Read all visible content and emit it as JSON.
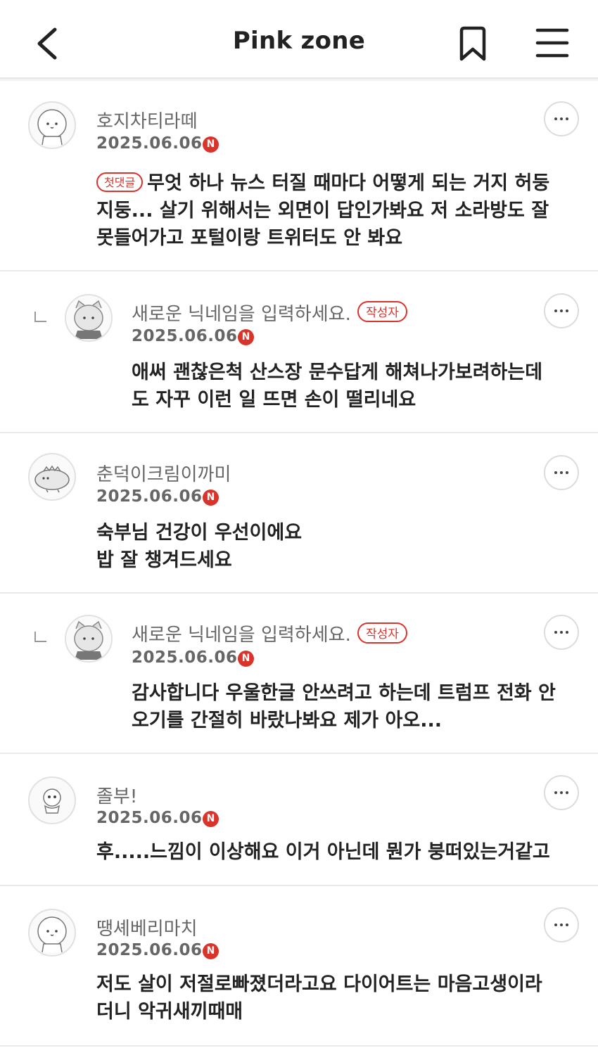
{
  "header": {
    "title": "Pink zone"
  },
  "icons": {
    "back": "chevron-left-icon",
    "bookmark": "bookmark-icon",
    "menu": "hamburger-menu-icon",
    "more": "more-horizontal-icon"
  },
  "colors": {
    "accent": "#d9342b",
    "text": "#222222",
    "muted": "#666666"
  },
  "badges": {
    "new": "N",
    "author": "작성자",
    "first_comment": "첫댓글"
  },
  "comments": [
    {
      "nickname": "호지차티라떼",
      "date": "2025.06.06",
      "line1": "무엇 하나 뉴스 터질 때마다 어떻게 되는 거지 허둥",
      "line2": "지둥... 살기 위해서는 외면이 답인가봐요 저 소라방도 잘",
      "line3": "못들어가고 포털이랑 트위터도 안 봐요"
    },
    {
      "nickname": "새로운 닉네임을 입력하세요.",
      "date": "2025.06.06",
      "line1": "애써 괜찮은척 산스장 문수답게 해쳐나가보려하는데",
      "line2": "도 자꾸 이런 일 뜨면 손이 떨리네요"
    },
    {
      "nickname": "춘덕이크림이까미",
      "date": "2025.06.06",
      "line1": "숙부님 건강이 우선이에요",
      "line2": "밥 잘 챙겨드세요"
    },
    {
      "nickname": "새로운 닉네임을 입력하세요.",
      "date": "2025.06.06",
      "line1": "감사합니다 우울한글 안쓰려고 하는데 트럼프 전화 안",
      "line2": "오기를 간절히 바랐나봐요 제가 아오..."
    },
    {
      "nickname": "졸부!",
      "date": "2025.06.06",
      "line1": "후.....느낌이 이상해요 이거 아닌데 뭔가 붕떠있는거같고"
    },
    {
      "nickname": "땡셰베리마치",
      "date": "2025.06.06",
      "line1": "저도 살이 저절로빠졌더라고요 다이어트는 마음고생이라",
      "line2": "더니 악귀새끼때매"
    }
  ]
}
